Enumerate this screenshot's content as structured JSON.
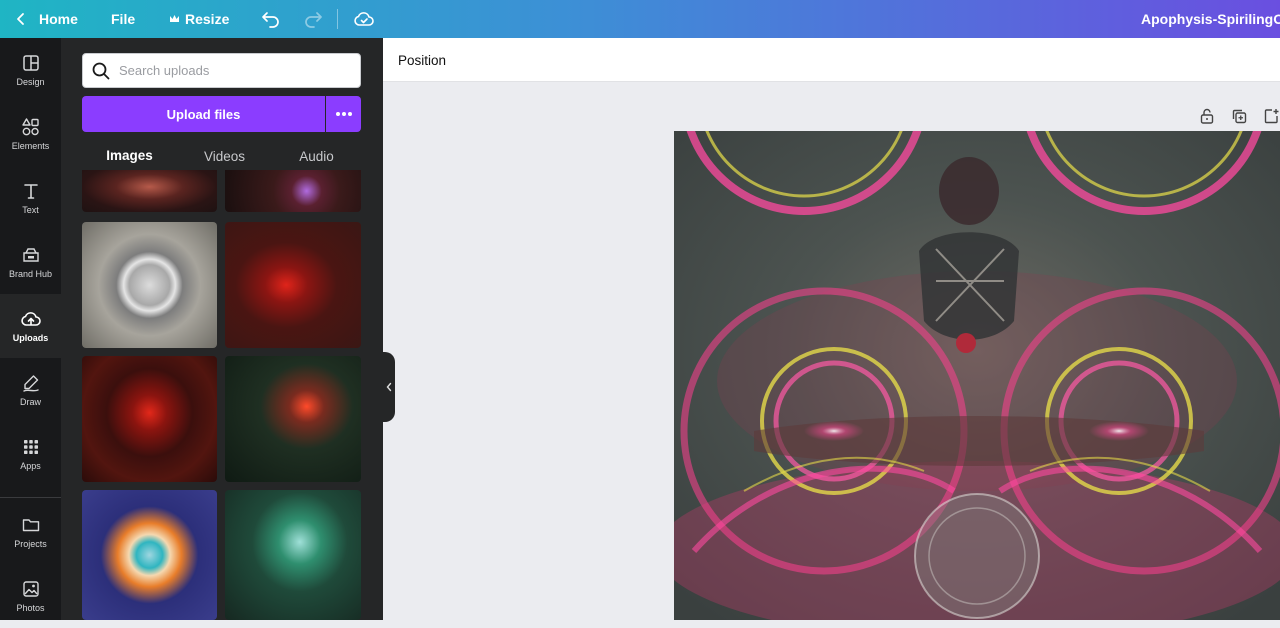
{
  "topbar": {
    "home_label": "Home",
    "file_label": "File",
    "resize_label": "Resize",
    "document_title": "Apophysis-SpirilingOut",
    "icons": [
      "chevron-left-icon",
      "crown-icon",
      "undo-icon",
      "redo-icon",
      "cloud-saved-icon"
    ]
  },
  "rail": {
    "items": [
      {
        "label": "Design",
        "icon": "layout-icon"
      },
      {
        "label": "Elements",
        "icon": "shapes-icon"
      },
      {
        "label": "Text",
        "icon": "text-icon"
      },
      {
        "label": "Brand Hub",
        "icon": "brand-icon"
      },
      {
        "label": "Uploads",
        "icon": "cloud-upload-icon",
        "active": true
      },
      {
        "label": "Draw",
        "icon": "pen-icon"
      },
      {
        "label": "Apps",
        "icon": "apps-grid-icon"
      },
      {
        "label": "Projects",
        "icon": "folder-icon"
      },
      {
        "label": "Photos",
        "icon": "image-icon"
      }
    ]
  },
  "panel": {
    "search_placeholder": "Search uploads",
    "upload_label": "Upload files",
    "tabs": [
      {
        "label": "Images",
        "active": true
      },
      {
        "label": "Videos",
        "active": false
      },
      {
        "label": "Audio",
        "active": false
      }
    ]
  },
  "toolbar": {
    "position_label": "Position"
  },
  "colors": {
    "accent": "#8b3dff",
    "rail_bg": "#18191b",
    "panel_bg": "#252627",
    "canvas_bg": "#ebecf0"
  }
}
